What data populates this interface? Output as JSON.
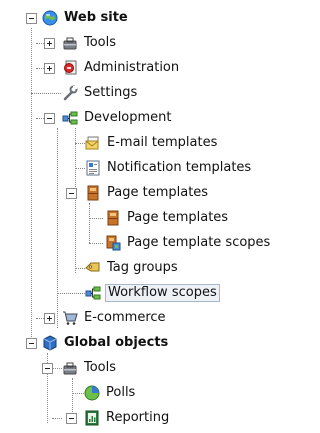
{
  "tree": {
    "web_site": {
      "label": "Web site",
      "icon": "globe-icon"
    },
    "tools": {
      "label": "Tools",
      "icon": "tools-icon"
    },
    "administration": {
      "label": "Administration",
      "icon": "administration-icon"
    },
    "settings": {
      "label": "Settings",
      "icon": "wrench-icon"
    },
    "development": {
      "label": "Development",
      "icon": "development-icon"
    },
    "email_templates": {
      "label": "E-mail templates",
      "icon": "email-template-icon"
    },
    "notification_templates": {
      "label": "Notification templates",
      "icon": "notification-template-icon"
    },
    "page_templates": {
      "label": "Page templates",
      "icon": "page-template-folder-icon"
    },
    "page_templates_child": {
      "label": "Page templates",
      "icon": "page-template-icon"
    },
    "page_template_scopes": {
      "label": "Page template scopes",
      "icon": "page-template-scope-icon"
    },
    "tag_groups": {
      "label": "Tag groups",
      "icon": "tag-icon"
    },
    "workflow_scopes": {
      "label": "Workflow scopes",
      "icon": "workflow-scope-icon",
      "selected": true
    },
    "ecommerce": {
      "label": "E-commerce",
      "icon": "cart-icon"
    },
    "global_objects": {
      "label": "Global objects",
      "icon": "cube-icon"
    },
    "global_tools": {
      "label": "Tools",
      "icon": "tools-icon"
    },
    "polls": {
      "label": "Polls",
      "icon": "poll-icon"
    },
    "reporting": {
      "label": "Reporting",
      "icon": "reporting-icon"
    }
  }
}
